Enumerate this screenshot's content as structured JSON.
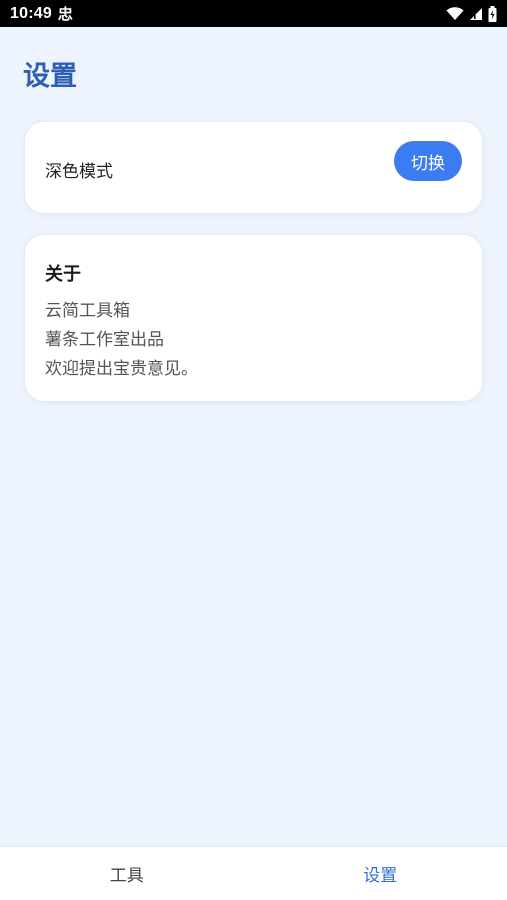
{
  "status_bar": {
    "time": "10:49",
    "notification_glyph": "忠",
    "icons": [
      "wifi-icon",
      "signal-icon",
      "battery-icon"
    ]
  },
  "page": {
    "title": "设置"
  },
  "theme_card": {
    "label": "深色模式",
    "button_label": "切换"
  },
  "about_card": {
    "title": "关于",
    "lines": [
      "云简工具箱",
      "薯条工作室出品",
      "欢迎提出宝贵意见。"
    ]
  },
  "bottom_nav": {
    "items": [
      {
        "label": "工具",
        "active": false
      },
      {
        "label": "设置",
        "active": true
      }
    ]
  },
  "colors": {
    "background": "#eef4fe",
    "title": "#2c5fae",
    "accent": "#3b7cf0",
    "nav_active": "#2f6fdb"
  }
}
